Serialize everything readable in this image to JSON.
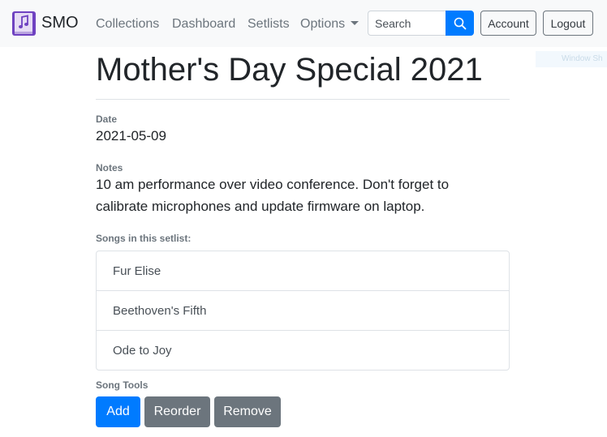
{
  "navbar": {
    "brand": "SMO",
    "links": [
      "Collections",
      "Dashboard",
      "Setlists",
      "Options"
    ],
    "search": {
      "placeholder": "Search",
      "value": ""
    },
    "account_label": "Account",
    "logout_label": "Logout"
  },
  "overlay_text": "Window Sh",
  "setlist": {
    "title": "Mother's Day Special 2021",
    "date_label": "Date",
    "date": "2021-05-09",
    "notes_label": "Notes",
    "notes_line1": "10 am performance over video conference. Don't forget to",
    "notes_line2": "calibrate microphones and update firmware on laptop.",
    "songs_label": "Songs in this setlist:",
    "songs": [
      "Fur Elise",
      "Beethoven's Fifth",
      "Ode to Joy"
    ],
    "tools_label": "Song Tools",
    "tools": {
      "add": "Add",
      "reorder": "Reorder",
      "remove": "Remove"
    }
  },
  "colors": {
    "primary": "#007bff",
    "secondary": "#6c757d",
    "logo_purple": "#6f42c1"
  },
  "icons": {
    "logo": "music-book-icon",
    "search": "search-icon",
    "caret": "caret-down-icon"
  }
}
